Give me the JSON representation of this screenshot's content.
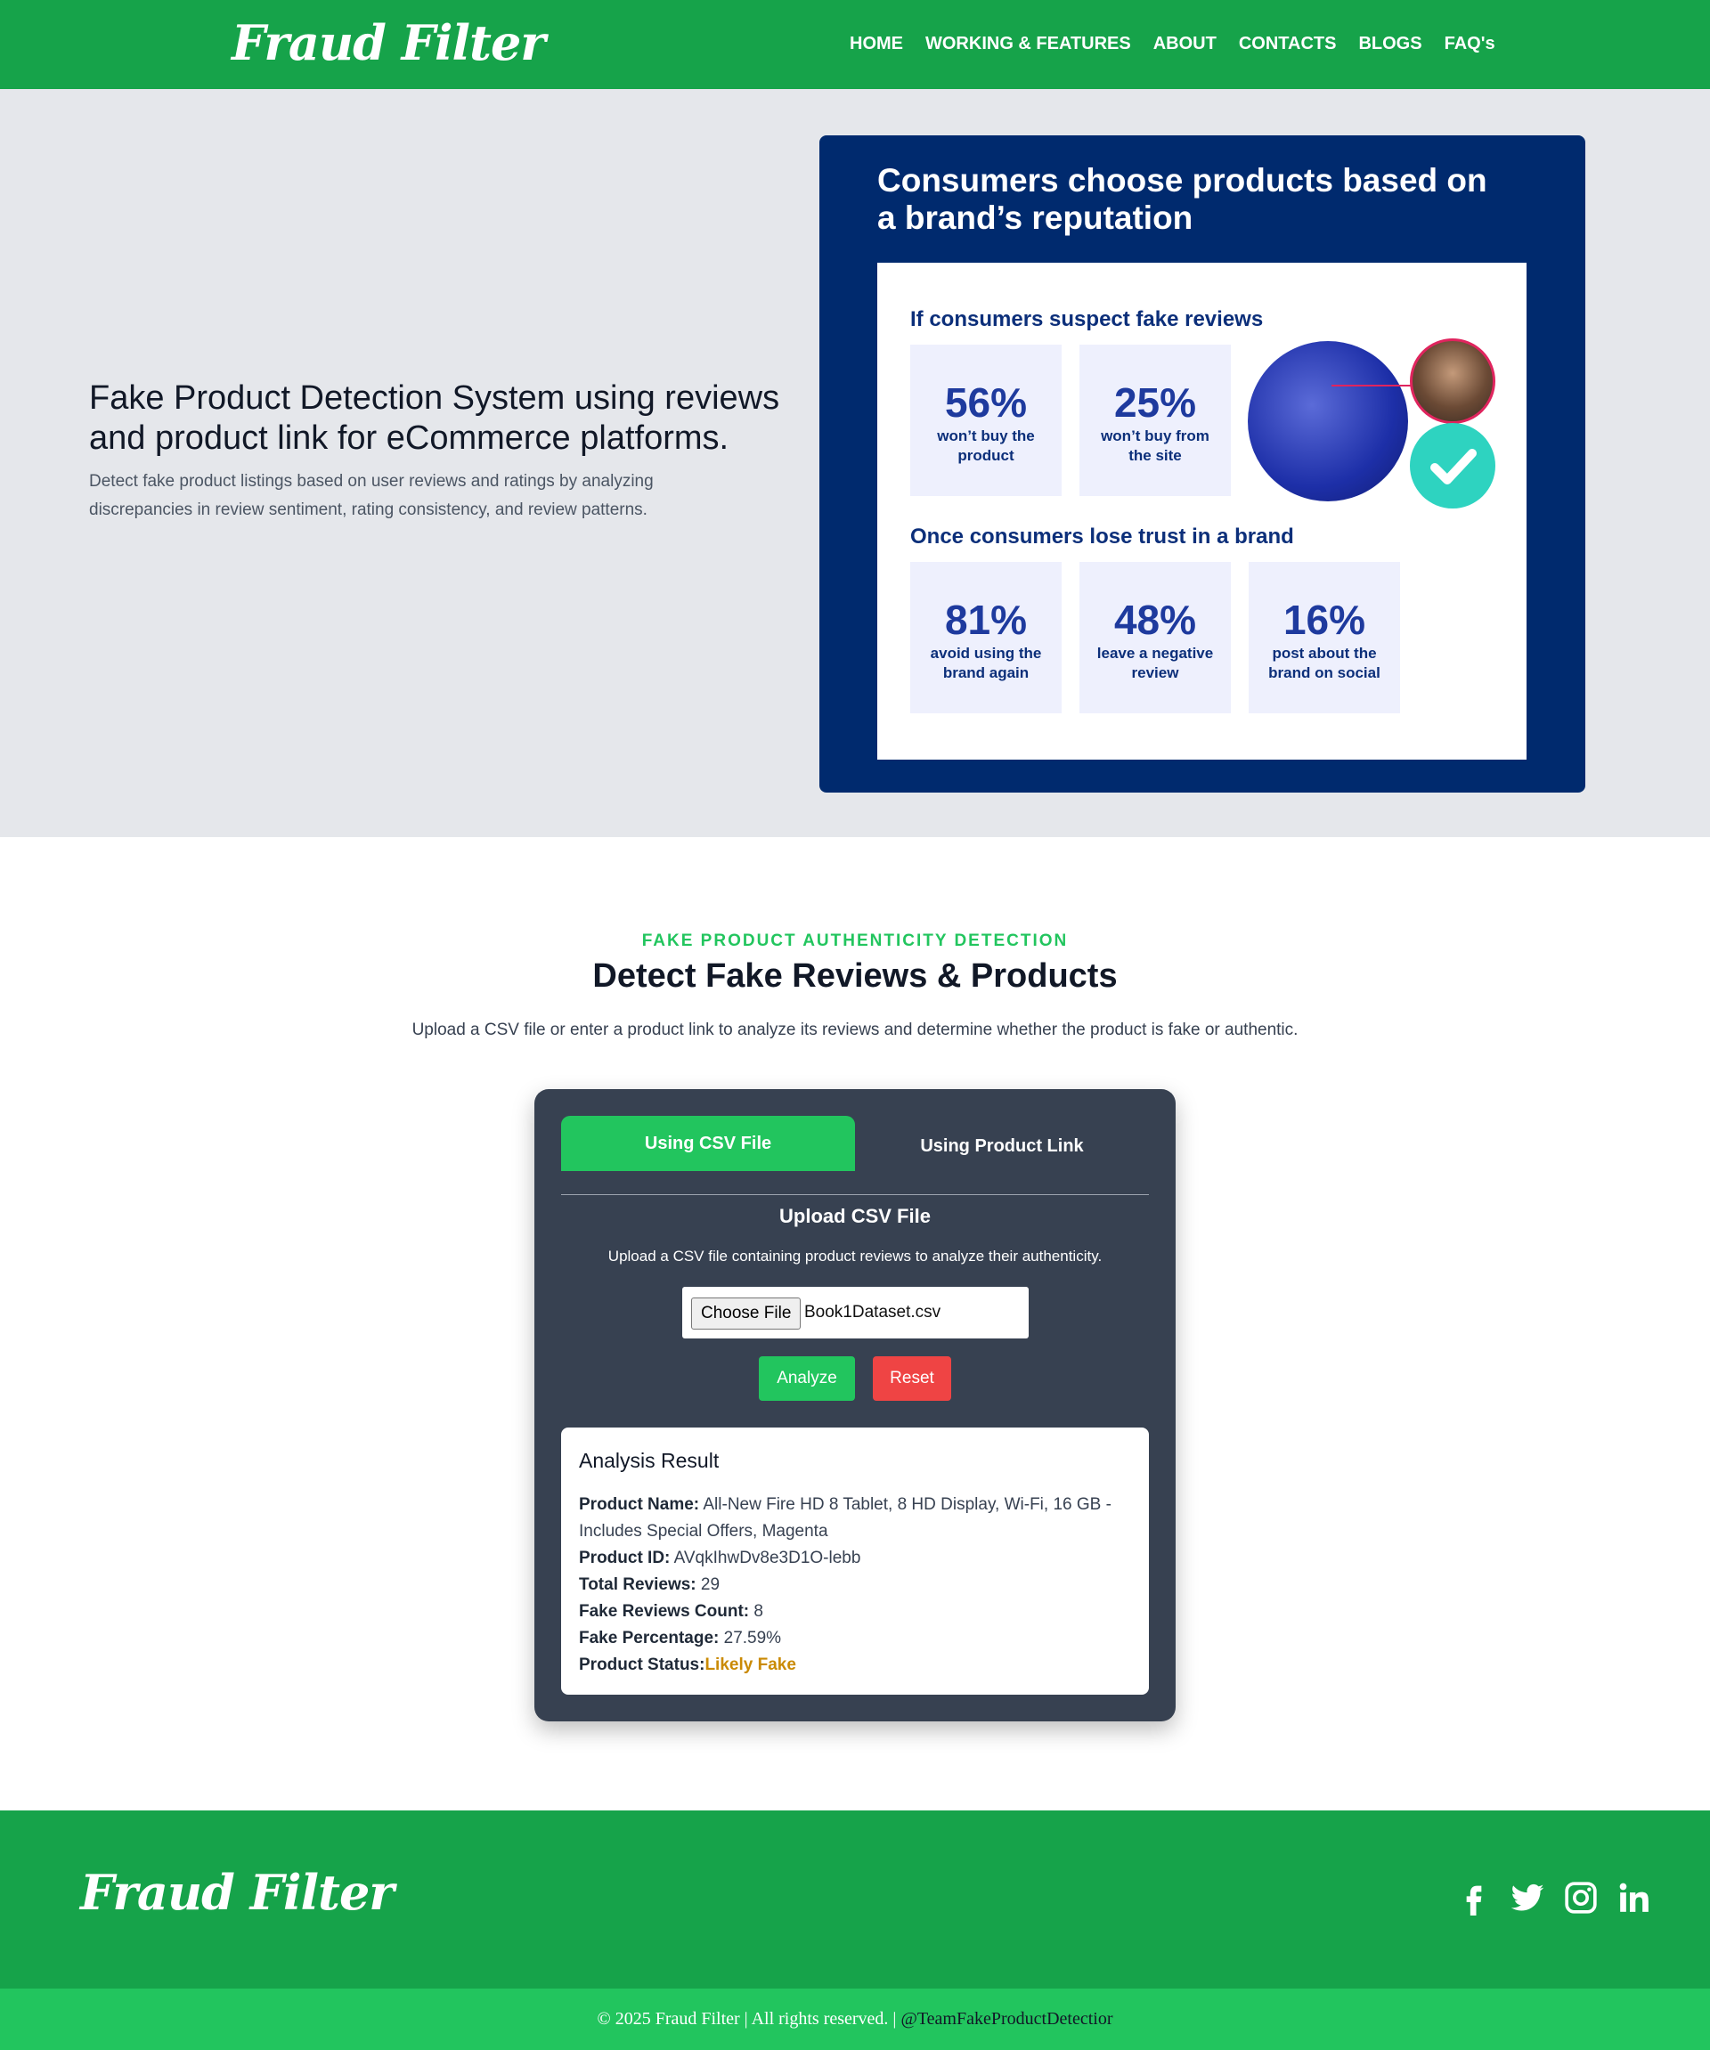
{
  "brand": {
    "name": "Fraud Filter"
  },
  "nav": {
    "items": [
      {
        "label": "HOME"
      },
      {
        "label": "WORKING & FEATURES"
      },
      {
        "label": "ABOUT"
      },
      {
        "label": "CONTACTS"
      },
      {
        "label": "BLOGS"
      },
      {
        "label": "FAQ's"
      }
    ]
  },
  "hero": {
    "title": "Fake Product Detection System using reviews and product link for eCommerce platforms.",
    "description": "Detect fake product listings based on user reviews and ratings by analyzing discrepancies in review sentiment, rating consistency, and review patterns."
  },
  "infographic": {
    "title": "Consumers choose products based on a brand’s reputation",
    "section1": "If consumers suspect fake reviews",
    "section2": "Once consumers lose trust in a brand",
    "stats1": [
      {
        "num": "56%",
        "label": "won’t buy the product"
      },
      {
        "num": "25%",
        "label": "won’t buy from the site"
      }
    ],
    "stats2": [
      {
        "num": "81%",
        "label": "avoid using the brand again"
      },
      {
        "num": "48%",
        "label": "leave a negative review"
      },
      {
        "num": "16%",
        "label": "post about the brand on social"
      }
    ]
  },
  "detect": {
    "eyebrow": "FAKE PRODUCT AUTHENTICITY DETECTION",
    "title": "Detect Fake Reviews & Products",
    "description": "Upload a CSV file or enter a product link to analyze its reviews and determine whether the product is fake or authentic."
  },
  "tool": {
    "tabs": [
      {
        "label": "Using CSV File"
      },
      {
        "label": "Using Product Link"
      }
    ],
    "upload_title": "Upload CSV File",
    "upload_desc": "Upload a CSV file containing product reviews to analyze their authenticity.",
    "choose_file_label": "Choose File",
    "file_name": "Book1Dataset.csv",
    "analyze_label": "Analyze",
    "reset_label": "Reset"
  },
  "result": {
    "heading": "Analysis Result",
    "product_name_label": "Product Name:",
    "product_name": "All-New Fire HD 8 Tablet, 8 HD Display, Wi-Fi, 16 GB - Includes Special Offers, Magenta",
    "product_id_label": "Product ID:",
    "product_id": "AVqkIhwDv8e3D1O-lebb",
    "total_reviews_label": "Total Reviews:",
    "total_reviews": "29",
    "fake_count_label": "Fake Reviews Count:",
    "fake_count": "8",
    "fake_pct_label": "Fake Percentage:",
    "fake_pct": "27.59%",
    "status_label": "Product Status:",
    "status": "Likely Fake"
  },
  "footer": {
    "copyright": "© 2025 Fraud Filter | All rights reserved. |",
    "handle": "@TeamFakeProductDetectior"
  },
  "colors": {
    "brand_green": "#16a34a",
    "accent_green": "#22c55e",
    "danger_red": "#ef4444",
    "warning_amber": "#ca8a04",
    "infographic_navy": "#002a6e"
  }
}
